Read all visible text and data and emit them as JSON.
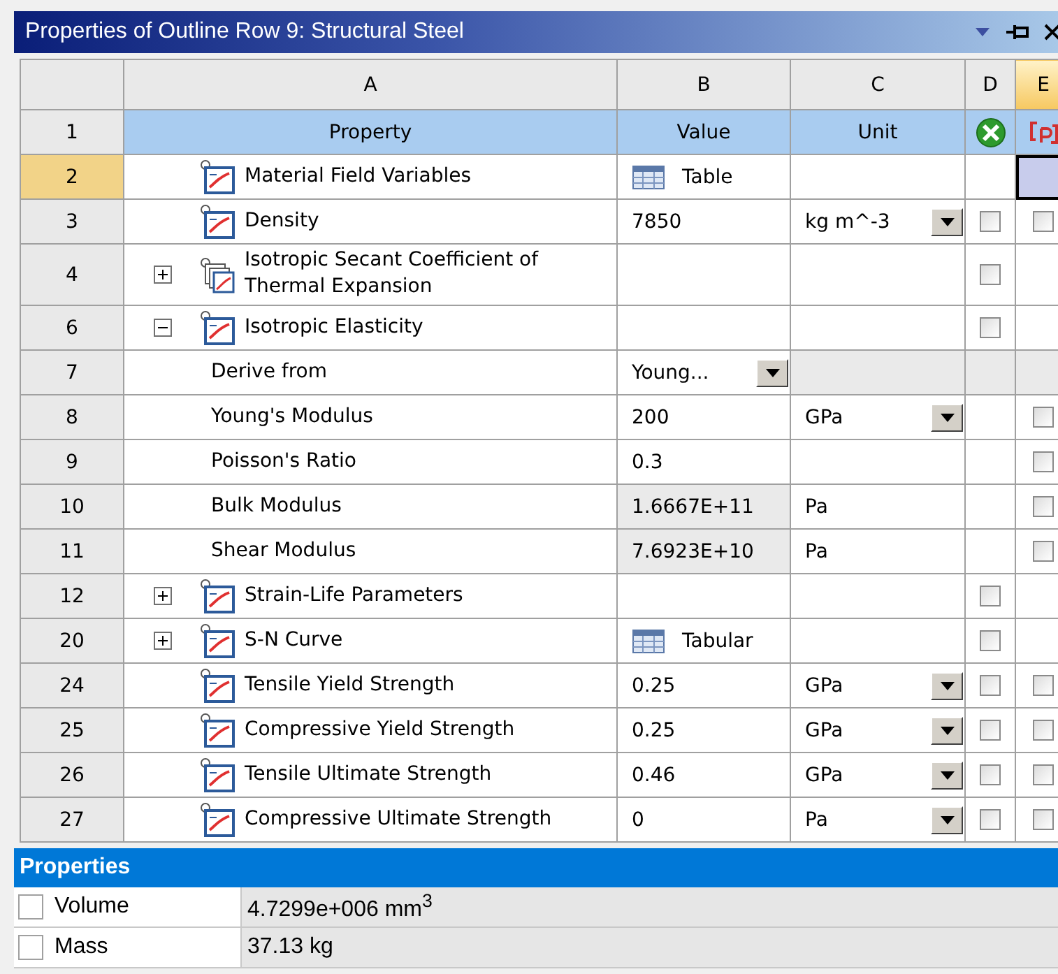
{
  "window": {
    "title": "Properties of Outline Row 9: Structural Steel"
  },
  "table": {
    "columns": [
      "A",
      "B",
      "C",
      "D",
      "E"
    ],
    "header": {
      "number": "1",
      "property": "Property",
      "value": "Value",
      "unit": "Unit"
    },
    "rows": [
      {
        "number": "2",
        "selected": true,
        "kind": "chart",
        "property": "Material Field Variables",
        "value": "Table",
        "value_table": true
      },
      {
        "number": "3",
        "selected": false,
        "kind": "chart",
        "property": "Density",
        "value": "7850",
        "unit": "kg m^-3",
        "unit_dropdown": true,
        "d": {
          "checked": false
        },
        "e": {
          "checked": false
        }
      },
      {
        "number": "4",
        "selected": false,
        "expanded": false,
        "kind": "stack",
        "property": "Isotropic Secant Coefficient of Thermal Expansion",
        "d": {
          "checked": false
        }
      },
      {
        "number": "6",
        "selected": false,
        "expanded": true,
        "kind": "chart",
        "property": "Isotropic Elasticity",
        "d": {
          "checked": false
        },
        "children": [
          {
            "number": "7",
            "selected": false,
            "property": "Derive from",
            "value": "Young...",
            "value_dropdown": true,
            "locked": true
          },
          {
            "number": "8",
            "selected": false,
            "property": "Young's Modulus",
            "value": "200",
            "unit": "GPa",
            "unit_dropdown": true,
            "e": {
              "checked": false
            }
          },
          {
            "number": "9",
            "selected": false,
            "property": "Poisson's Ratio",
            "value": "0.3",
            "e": {
              "checked": false
            }
          },
          {
            "number": "10",
            "selected": false,
            "property": "Bulk Modulus",
            "value": "1.6667E+11",
            "value_readonly": true,
            "unit": "Pa",
            "e": {
              "checked": false
            }
          },
          {
            "number": "11",
            "selected": false,
            "property": "Shear Modulus",
            "value": "7.6923E+10",
            "value_readonly": true,
            "unit": "Pa",
            "e": {
              "checked": false
            }
          }
        ]
      },
      {
        "number": "12",
        "selected": false,
        "expanded": false,
        "kind": "chart",
        "property": "Strain-Life Parameters",
        "d": {
          "checked": false
        }
      },
      {
        "number": "20",
        "selected": false,
        "expanded": false,
        "kind": "chart",
        "property": "S-N Curve",
        "value": "Tabular",
        "value_table": true,
        "d": {
          "checked": false
        }
      },
      {
        "number": "24",
        "selected": false,
        "kind": "chart",
        "property": "Tensile Yield Strength",
        "value": "0.25",
        "unit": "GPa",
        "unit_dropdown": true,
        "d": {
          "checked": false
        },
        "e": {
          "checked": false
        }
      },
      {
        "number": "25",
        "selected": false,
        "kind": "chart",
        "property": "Compressive Yield Strength",
        "value": "0.25",
        "unit": "GPa",
        "unit_dropdown": true,
        "d": {
          "checked": false
        },
        "e": {
          "checked": false
        }
      },
      {
        "number": "26",
        "selected": false,
        "kind": "chart",
        "property": "Tensile Ultimate Strength",
        "value": "0.46",
        "unit": "GPa",
        "unit_dropdown": true,
        "d": {
          "checked": false
        },
        "e": {
          "checked": false
        }
      },
      {
        "number": "27",
        "selected": false,
        "kind": "chart",
        "property": "Compressive Ultimate Strength",
        "value": "0",
        "unit": "Pa",
        "unit_dropdown": true,
        "d": {
          "checked": false
        },
        "e": {
          "checked": false
        }
      }
    ]
  },
  "properties": {
    "title": "Properties",
    "rows": [
      {
        "label": "Volume",
        "value": "4.7299e+006 mm$^{3}$",
        "checked": false
      },
      {
        "label": "Mass",
        "value": "37.13 kg",
        "checked": false
      }
    ]
  }
}
